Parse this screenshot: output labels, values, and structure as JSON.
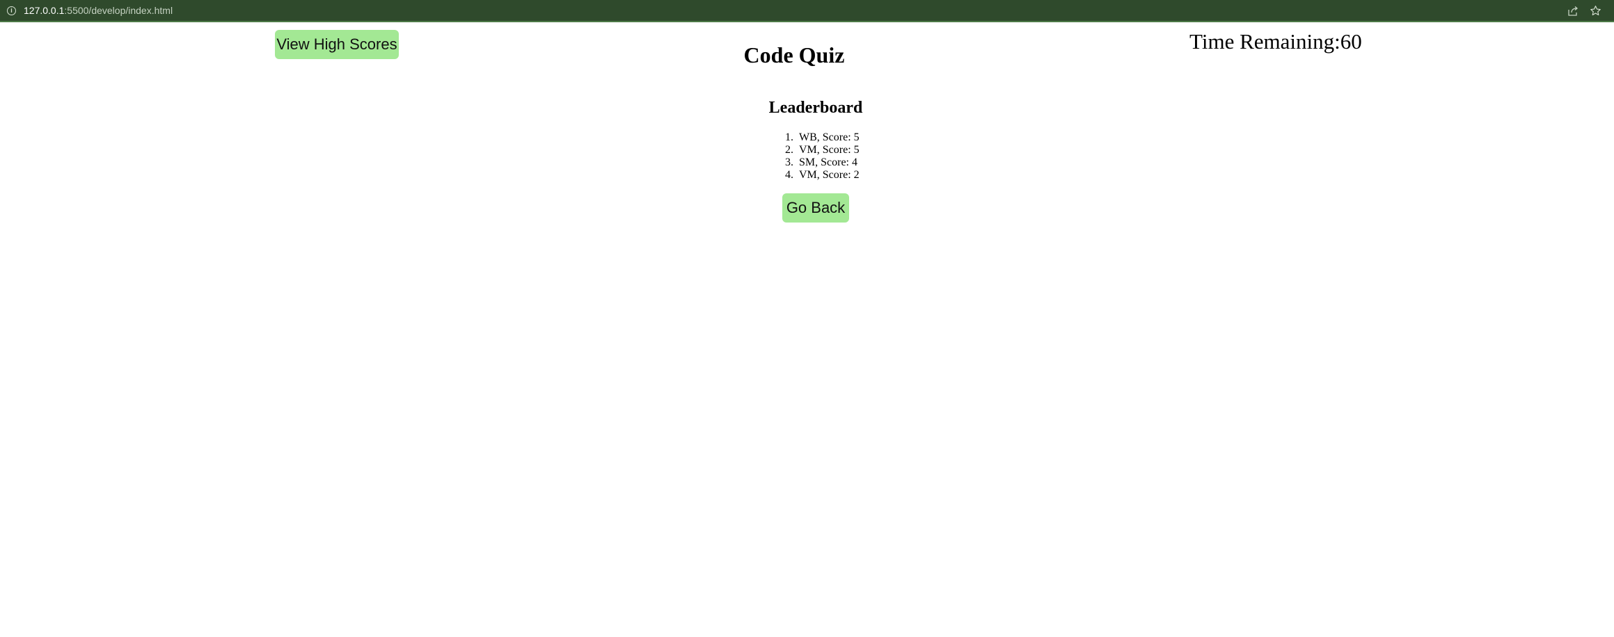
{
  "browser": {
    "url_host": "127.0.0.1",
    "url_rest": ":5500/develop/index.html",
    "info_icon": "info-icon",
    "share_icon": "share-icon",
    "star_icon": "star-icon"
  },
  "header": {
    "view_high_scores_label": "View High Scores",
    "title": "Code Quiz",
    "timer_text": "Time Remaining:60"
  },
  "leaderboard": {
    "title": "Leaderboard",
    "entries": [
      {
        "num": "1.",
        "text": "WB, Score: 5"
      },
      {
        "num": "2.",
        "text": "VM, Score: 5"
      },
      {
        "num": "3.",
        "text": "SM, Score: 4"
      },
      {
        "num": "4.",
        "text": "VM, Score: 2"
      }
    ],
    "go_back_label": "Go Back"
  },
  "colors": {
    "browser_bar": "#2f4a2c",
    "button_bg": "#a3e894"
  }
}
